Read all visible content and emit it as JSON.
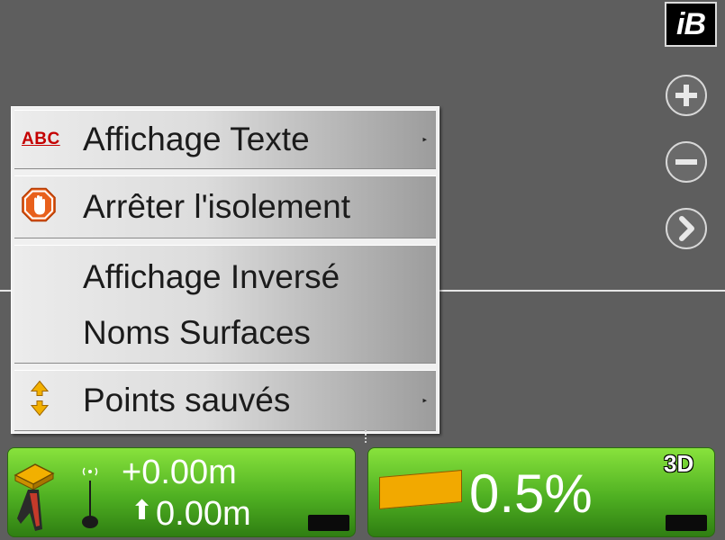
{
  "brand": {
    "logo_text": "iB"
  },
  "toolbar": {
    "zoom_in_icon": "plus-circle",
    "zoom_out_icon": "minus-circle",
    "next_icon": "chevron-right-circle"
  },
  "menu": {
    "items": [
      {
        "icon": "abc-text-icon",
        "icon_text": "ABC",
        "label": "Affichage Texte",
        "has_submenu": true
      },
      {
        "icon": "stop-hand-icon",
        "label": "Arrêter l'isolement",
        "has_submenu": false
      },
      {
        "icon": "",
        "label": "Affichage Inversé",
        "has_submenu": false
      },
      {
        "icon": "",
        "label": "Noms Surfaces",
        "has_submenu": false
      },
      {
        "icon": "up-down-arrows-icon",
        "label": "Points sauvés",
        "has_submenu": true
      }
    ],
    "submenu_arrow": "▸"
  },
  "status_left": {
    "vertical_offset": "+0.00m",
    "height_value": "0.00m",
    "height_arrow": "⬆",
    "colors": {
      "panel_top": "#88e23c",
      "panel_bottom": "#2f7e12"
    }
  },
  "status_right": {
    "badge": "3D",
    "slope": "0.5%",
    "slope_bar_color": "#f2a900"
  }
}
